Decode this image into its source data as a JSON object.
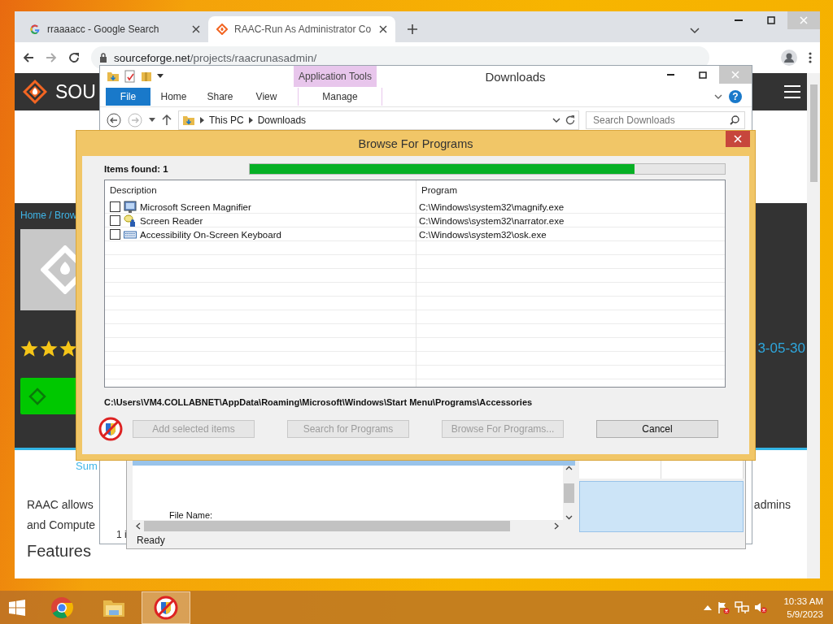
{
  "browser": {
    "tabs": [
      {
        "title": "rraaaacc - Google Search",
        "selected": false
      },
      {
        "title": "RAAC-Run As Administrator Co",
        "selected": true
      }
    ],
    "address": {
      "domain": "sourceforge.net",
      "path": "/projects/raacrunasadmin/"
    },
    "page": {
      "logo_text": "SOU",
      "breadcrumb": "Home / Brow",
      "stars": 3,
      "date": "3-05-30",
      "link": "Sum",
      "lines": [
        {
          "left": "RAAC allows",
          "right": "admins"
        },
        {
          "left": "and Compute"
        }
      ],
      "heading": "Features"
    }
  },
  "explorer": {
    "title": "Downloads",
    "context_tab": "Application Tools",
    "ribbon_tabs": [
      {
        "label": "File",
        "kind": "file"
      },
      {
        "label": "Home",
        "kind": "tab"
      },
      {
        "label": "Share",
        "kind": "tab"
      },
      {
        "label": "View",
        "kind": "tab"
      },
      {
        "label": "Manage",
        "kind": "context"
      }
    ],
    "help": "?",
    "breadcrumb": [
      "This PC",
      "Downloads"
    ],
    "search": {
      "placeholder": "Search Downloads"
    },
    "status": "1 i"
  },
  "raac_window": {
    "file_name_label": "File Name:",
    "status": "Ready"
  },
  "dialog": {
    "title": "Browse For Programs",
    "items_found": "Items found: 1",
    "progress": {
      "level": 0.81
    },
    "columns": [
      "Description",
      "Program"
    ],
    "rows": [
      {
        "kind": "magnifier",
        "checked": false,
        "description": "Microsoft Screen Magnifier",
        "program": "C:\\Windows\\system32\\magnify.exe"
      },
      {
        "kind": "narrator",
        "checked": false,
        "description": "Screen Reader",
        "program": "C:\\Windows\\system32\\narrator.exe"
      },
      {
        "kind": "keyboard",
        "checked": false,
        "description": "Accessibility On-Screen Keyboard",
        "program": "C:\\Windows\\system32\\osk.exe"
      }
    ],
    "path": "C:\\Users\\VM4.COLLABNET\\AppData\\Roaming\\Microsoft\\Windows\\Start Menu\\Programs\\Accessories",
    "buttons": [
      {
        "label": "Add selected items",
        "disabled": true
      },
      {
        "label": "Search for Programs",
        "disabled": true
      },
      {
        "label": "Browse For Programs...",
        "disabled": true
      },
      {
        "label": "Cancel",
        "disabled": false
      }
    ]
  },
  "taskbar": {
    "apps": [
      {
        "kind": "chrome",
        "selected": false
      },
      {
        "kind": "explorer",
        "selected": false
      },
      {
        "kind": "raac",
        "selected": true
      }
    ],
    "clock": {
      "time": "10:33 AM",
      "date": "5/9/2023"
    }
  }
}
